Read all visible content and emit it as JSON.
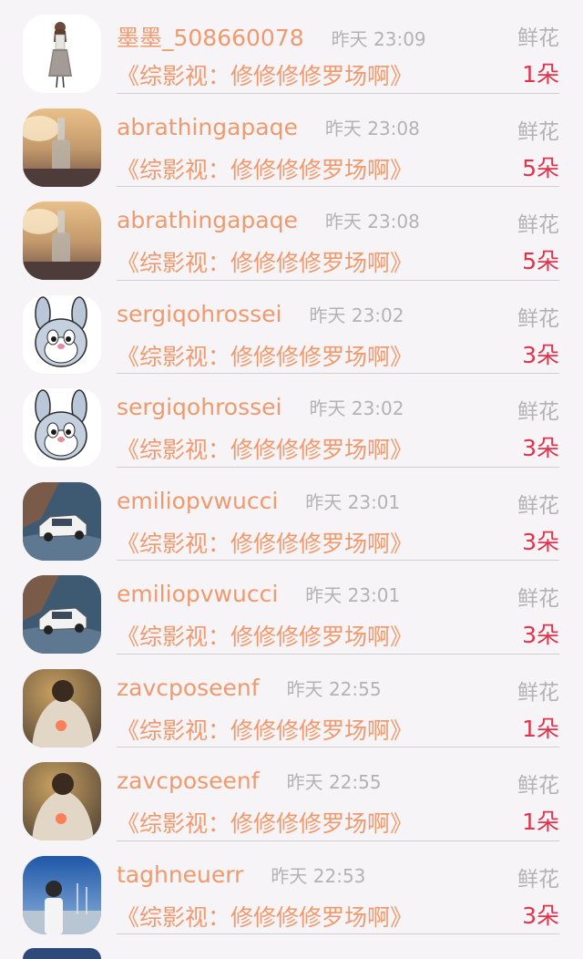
{
  "list": {
    "items": [
      {
        "name": "墨墨_508660078",
        "time": "昨天 23:09",
        "gift": "鲜花",
        "work": "《综影视：修修修修罗场啊》",
        "count": "1朵",
        "avatar": "avatar-girl-sketch"
      },
      {
        "name": "abrathingapaqe",
        "time": "昨天 23:08",
        "gift": "鲜花",
        "work": "《综影视：修修修修罗场啊》",
        "count": "5朵",
        "avatar": "avatar-bottle-beach"
      },
      {
        "name": "abrathingapaqe",
        "time": "昨天 23:08",
        "gift": "鲜花",
        "work": "《综影视：修修修修罗场啊》",
        "count": "5朵",
        "avatar": "avatar-bottle-beach"
      },
      {
        "name": "sergiqohrossei",
        "time": "昨天 23:02",
        "gift": "鲜花",
        "work": "《综影视：修修修修罗场啊》",
        "count": "3朵",
        "avatar": "avatar-cartoon-bunny"
      },
      {
        "name": "sergiqohrossei",
        "time": "昨天 23:02",
        "gift": "鲜花",
        "work": "《综影视：修修修修罗场啊》",
        "count": "3朵",
        "avatar": "avatar-cartoon-bunny"
      },
      {
        "name": "emiliopvwucci",
        "time": "昨天 23:01",
        "gift": "鲜花",
        "work": "《综影视：修修修修罗场啊》",
        "count": "3朵",
        "avatar": "avatar-white-suv"
      },
      {
        "name": "emiliopvwucci",
        "time": "昨天 23:01",
        "gift": "鲜花",
        "work": "《综影视：修修修修罗场啊》",
        "count": "3朵",
        "avatar": "avatar-white-suv"
      },
      {
        "name": "zavcposeenf",
        "time": "昨天 22:55",
        "gift": "鲜花",
        "work": "《综影视：修修修修罗场啊》",
        "count": "1朵",
        "avatar": "avatar-man-back"
      },
      {
        "name": "zavcposeenf",
        "time": "昨天 22:55",
        "gift": "鲜花",
        "work": "《综影视：修修修修罗场啊》",
        "count": "1朵",
        "avatar": "avatar-man-back"
      },
      {
        "name": "taghneuerr",
        "time": "昨天 22:53",
        "gift": "鲜花",
        "work": "《综影视：修修修修罗场啊》",
        "count": "3朵",
        "avatar": "avatar-person-harbor"
      }
    ]
  },
  "colors": {
    "background": "#f7f4f7",
    "name_orange": "#ef9a6e",
    "time_gray": "#b3b3b3",
    "count_red": "#e0344c",
    "divider": "#cfcfcf"
  }
}
